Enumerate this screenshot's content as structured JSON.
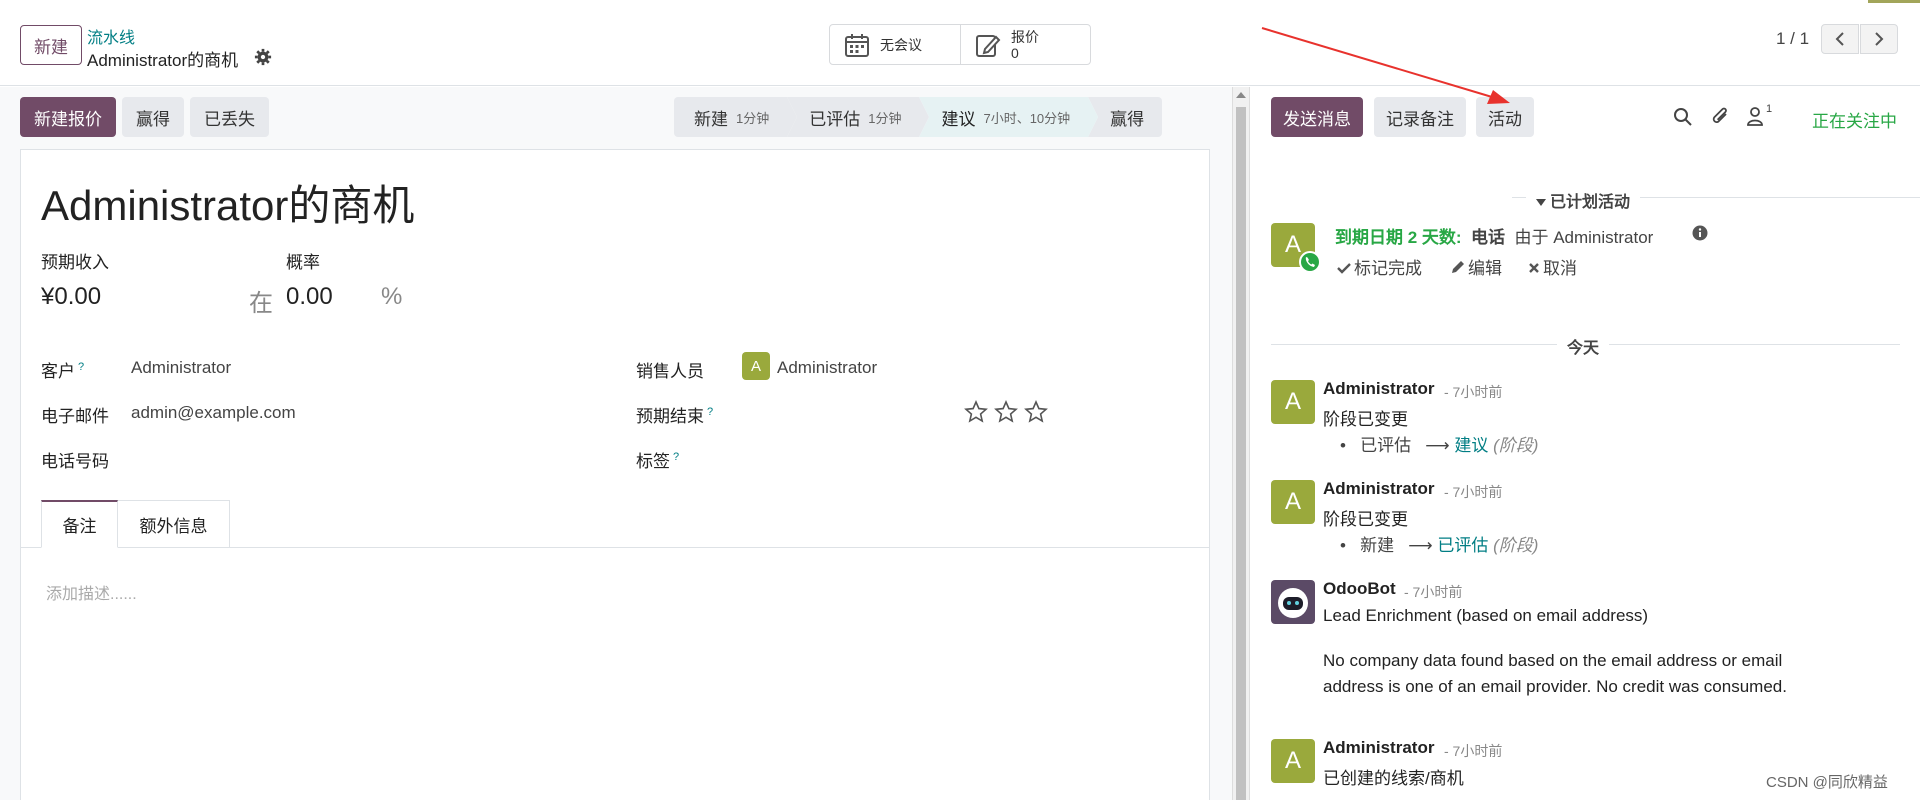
{
  "topbar": {
    "new_button": "新建",
    "breadcrumb_parent": "流水线",
    "breadcrumb_current": "Administrator的商机",
    "meeting_label": "无会议",
    "quote_label": "报价",
    "quote_count": "0",
    "pager": "1 / 1"
  },
  "form": {
    "actions": [
      "新建报价",
      "赢得",
      "已丢失"
    ],
    "stages": [
      {
        "name": "新建",
        "time": "1分钟"
      },
      {
        "name": "已评估",
        "time": "1分钟"
      },
      {
        "name": "建议",
        "time": "7小时、10分钟"
      },
      {
        "name": "赢得",
        "time": ""
      }
    ],
    "active_stage": "建议",
    "title": "Administrator的商机",
    "expected_revenue_label": "预期收入",
    "expected_revenue": "¥0.00",
    "probability_label": "概率",
    "at_label": "在",
    "probability": "0.00",
    "percent": "%",
    "customer_label": "客户",
    "customer": "Administrator",
    "email_label": "电子邮件",
    "email": "admin@example.com",
    "phone_label": "电话号码",
    "salesperson_label": "销售人员",
    "salesperson": "Administrator",
    "salesperson_initial": "A",
    "expected_close_label": "预期结束",
    "tags_label": "标签",
    "help_mark": "?",
    "priority_stars": 0,
    "tabs": [
      "备注",
      "额外信息"
    ],
    "notes_placeholder": "添加描述......"
  },
  "chatter": {
    "send_message": "发送消息",
    "log_note": "记录备注",
    "activity": "活动",
    "followers_count": "1",
    "following": "正在关注中",
    "planned_header": "已计划活动",
    "activity_item": {
      "avatar": "A",
      "due": "到期日期 2 天数:",
      "type": "电话",
      "by": "由于 Administrator",
      "mark_done": "标记完成",
      "edit": "编辑",
      "cancel": "取消"
    },
    "today_header": "今天",
    "messages": [
      {
        "author": "Administrator",
        "time": "- 7小时前",
        "text": "阶段已变更",
        "from": "已评估",
        "to": "建议",
        "field": "(阶段)"
      },
      {
        "author": "Administrator",
        "time": "- 7小时前",
        "text": "阶段已变更",
        "from": "新建",
        "to": "已评估",
        "field": "(阶段)"
      },
      {
        "author": "OdooBot",
        "time": "- 7小时前",
        "text": "Lead Enrichment (based on email address)",
        "body1": "No company data found based on the email address or email",
        "body2": "address is one of an email provider. No credit was consumed."
      },
      {
        "author": "Administrator",
        "time": "- 7小时前",
        "text": "已创建的线索/商机"
      }
    ],
    "avatar_initial": "A"
  },
  "watermark": "CSDN @同欣精益",
  "colors": {
    "primary": "#714b67",
    "link": "#017e84",
    "success": "#28a745",
    "avatar": "#9aa93c",
    "annotation_arrow": "#e8322d"
  }
}
